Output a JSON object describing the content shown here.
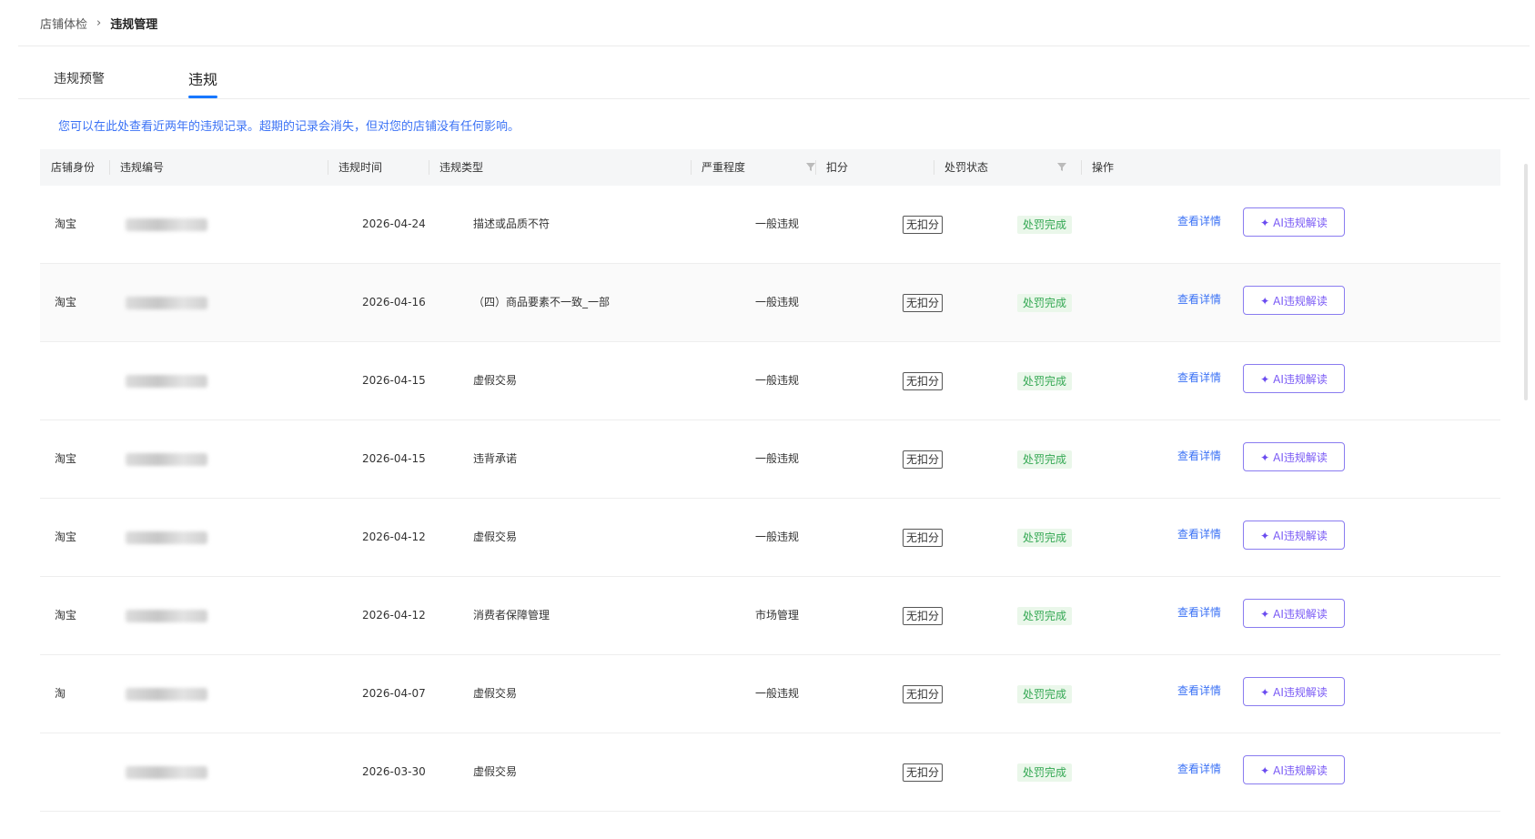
{
  "breadcrumb": {
    "parent": "店铺体检",
    "separator": "›",
    "current": "违规管理"
  },
  "tabs": [
    {
      "label": "违规预警"
    },
    {
      "label": "违规"
    }
  ],
  "notice": "您可以在此处查看近两年的违规记录。超期的记录会消失，但对您的店铺没有任何影响。",
  "table": {
    "headers": {
      "shop_identity": "店铺身份",
      "violation_id": "违规编号",
      "violation_time": "违规时间",
      "violation_type": "违规类型",
      "severity": "严重程度",
      "deduction": "扣分",
      "penalty_status": "处罚状态",
      "actions": "操作"
    },
    "rows": [
      {
        "shop": "淘宝",
        "time": "2026-04-24",
        "type": "描述或品质不符",
        "severity": "一般违规",
        "deduction": "无扣分",
        "status": "处罚完成",
        "detail": "查看详情",
        "ai": "AI违规解读"
      },
      {
        "shop": "淘宝",
        "time": "2026-04-16",
        "type": "（四）商品要素不一致_一部",
        "severity": "一般违规",
        "deduction": "无扣分",
        "status": "处罚完成",
        "detail": "查看详情",
        "ai": "AI违规解读"
      },
      {
        "shop": "",
        "time": "2026-04-15",
        "type": "虚假交易",
        "severity": "一般违规",
        "deduction": "无扣分",
        "status": "处罚完成",
        "detail": "查看详情",
        "ai": "AI违规解读"
      },
      {
        "shop": "淘宝",
        "time": "2026-04-15",
        "type": "违背承诺",
        "severity": "一般违规",
        "deduction": "无扣分",
        "status": "处罚完成",
        "detail": "查看详情",
        "ai": "AI违规解读"
      },
      {
        "shop": "淘宝",
        "time": "2026-04-12",
        "type": "虚假交易",
        "severity": "一般违规",
        "deduction": "无扣分",
        "status": "处罚完成",
        "detail": "查看详情",
        "ai": "AI违规解读"
      },
      {
        "shop": "淘宝",
        "time": "2026-04-12",
        "type": "消费者保障管理",
        "severity": "市场管理",
        "deduction": "无扣分",
        "status": "处罚完成",
        "detail": "查看详情",
        "ai": "AI违规解读"
      },
      {
        "shop": "淘",
        "time": "2026-04-07",
        "type": "虚假交易",
        "severity": "一般违规",
        "deduction": "无扣分",
        "status": "处罚完成",
        "detail": "查看详情",
        "ai": "AI违规解读"
      },
      {
        "shop": "",
        "time": "2026-03-30",
        "type": "虚假交易",
        "severity": "",
        "deduction": "无扣分",
        "status": "处罚完成",
        "detail": "查看详情",
        "ai": "AI违规解读"
      }
    ]
  },
  "colors": {
    "accent": "#1677ff",
    "link": "#3b72f5",
    "ai_border": "#8a7cf0",
    "ai_text": "#7a5af5",
    "status_bg": "#eaf7ea",
    "status_text": "#34a853"
  },
  "icons": {
    "filter": "filter-icon",
    "sparkle": "sparkle-icon",
    "separator": "chevron-right-icon"
  }
}
